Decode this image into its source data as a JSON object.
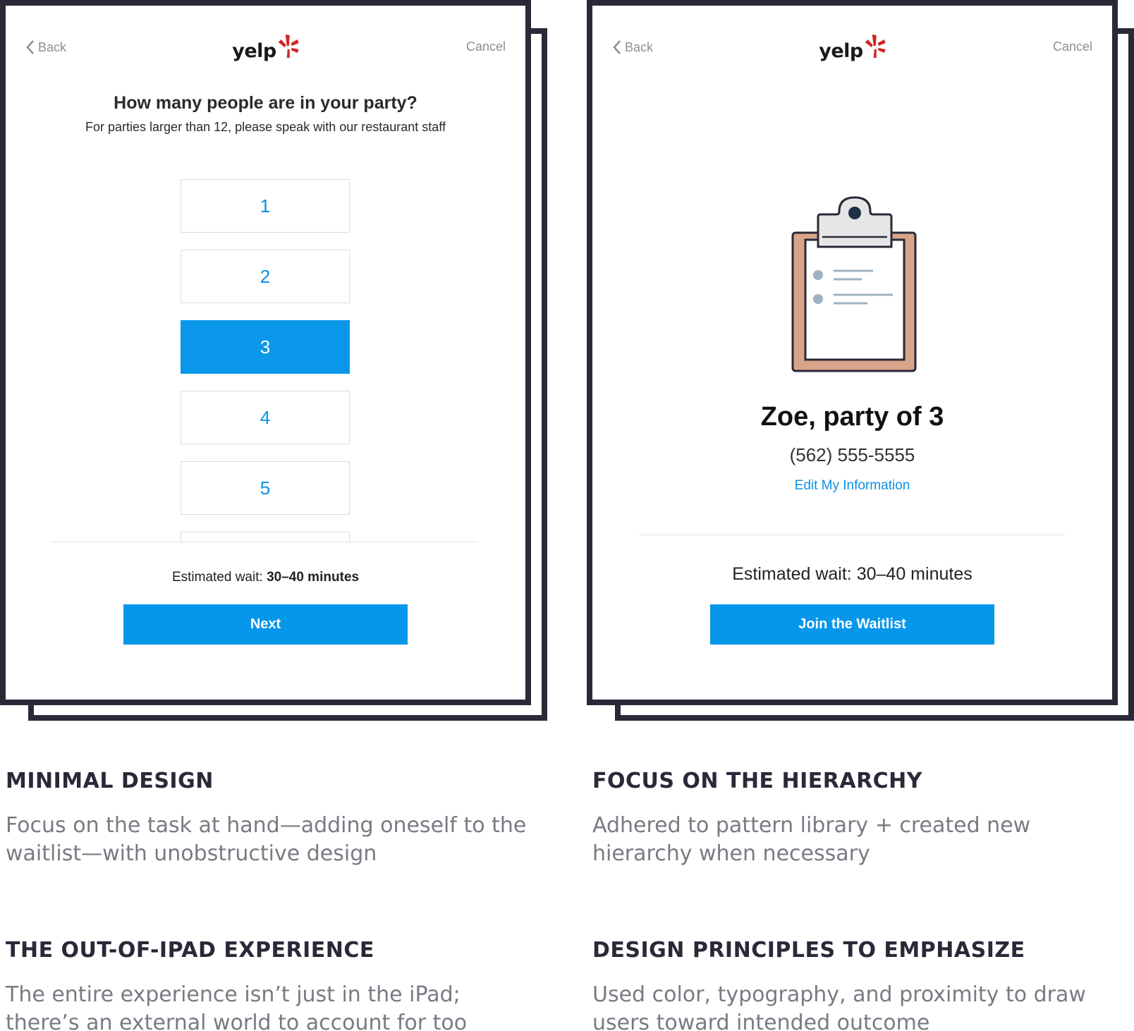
{
  "colors": {
    "frame": "#2b2838",
    "accent": "#0a97ea",
    "muted": "#8e8e93",
    "caption_body": "#7a7a84"
  },
  "screen_left": {
    "nav": {
      "back": "Back",
      "cancel": "Cancel",
      "logo": "yelp"
    },
    "title": "How many people are in your party?",
    "subtitle": "For parties larger than 12, please speak with our restaurant staff",
    "options": [
      "1",
      "2",
      "3",
      "4",
      "5"
    ],
    "selected": "3",
    "wait_label": "Estimated wait:",
    "wait_value": "30–40 minutes",
    "button": "Next"
  },
  "screen_right": {
    "nav": {
      "back": "Back",
      "cancel": "Cancel",
      "logo": "yelp"
    },
    "illustration": "clipboard-icon",
    "name_line": "Zoe, party of 3",
    "phone": "(562) 555-5555",
    "edit_link": "Edit My Information",
    "wait_label": "Estimated wait:",
    "wait_value": "30–40 minutes",
    "button": "Join the Waitlist"
  },
  "captions": [
    {
      "heading": "MINIMAL DESIGN",
      "body": "Focus on the task at hand—adding oneself to the waitlist—with unobstructive design"
    },
    {
      "heading": "FOCUS ON THE HIERARCHY",
      "body": "Adhered to pattern library + created new hierarchy when necessary"
    },
    {
      "heading": "THE OUT-OF-IPAD EXPERIENCE",
      "body": "The entire experience isn’t just in the iPad; there’s an external world to account for too"
    },
    {
      "heading": "DESIGN PRINCIPLES TO EMPHASIZE",
      "body": "Used color, typography, and proximity to draw users toward intended outcome"
    }
  ]
}
